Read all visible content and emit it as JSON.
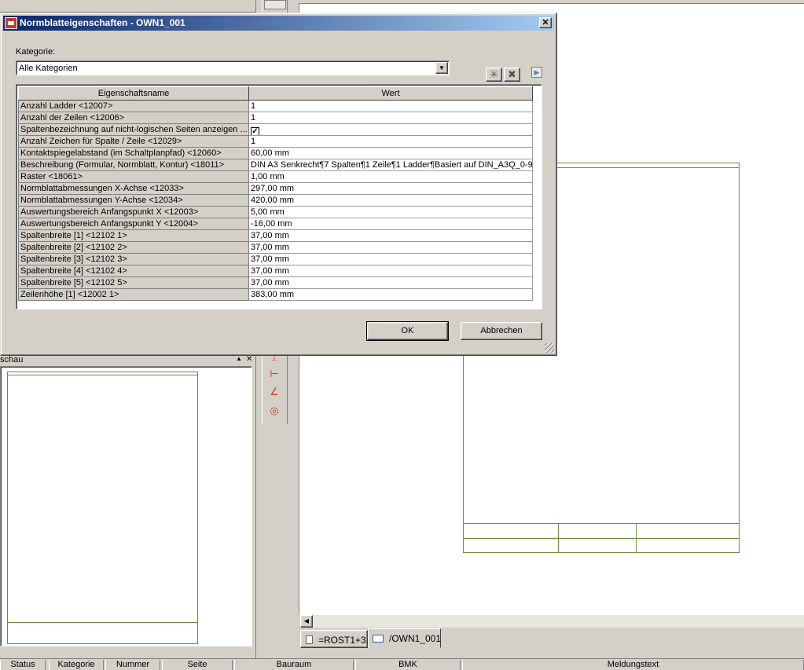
{
  "dialog": {
    "title": "Normblatteigenschaften - OWN1_001",
    "category_label": "Kategorie:",
    "category_value": "Alle Kategorien",
    "columns": {
      "name": "Eigenschaftsname",
      "value": "Wert"
    },
    "rows": [
      {
        "name": "Anzahl Ladder <12007>",
        "value": "1"
      },
      {
        "name": "Anzahl der Zeilen <12006>",
        "value": "1"
      },
      {
        "name": "Spaltenbezeichnung auf nicht-logischen Seiten anzeigen ...",
        "value": "✓",
        "checkbox": true
      },
      {
        "name": "Anzahl Zeichen für Spalte / Zeile <12029>",
        "value": "1"
      },
      {
        "name": "Kontaktspiegelabstand (im Schaltplanpfad) <12060>",
        "value": "60,00 mm"
      },
      {
        "name": "Beschreibung (Formular, Normblatt, Kontur) <18011>",
        "value": "DIN A3 Senkrecht¶7 Spalten¶1 Zeile¶1 Ladder¶Basiert auf DIN_A3Q_0-9"
      },
      {
        "name": "Raster <18061>",
        "value": "1,00 mm"
      },
      {
        "name": "Normblattabmessungen X-Achse <12033>",
        "value": "297,00 mm"
      },
      {
        "name": "Normblattabmessungen Y-Achse <12034>",
        "value": "420,00 mm"
      },
      {
        "name": "Auswertungsbereich Anfangspunkt X <12003>",
        "value": "5,00 mm"
      },
      {
        "name": "Auswertungsbereich Anfangspunkt Y <12004>",
        "value": "-16,00 mm"
      },
      {
        "name": "Spaltenbreite [1] <12102 1>",
        "value": "37,00 mm"
      },
      {
        "name": "Spaltenbreite [2] <12102 2>",
        "value": "37,00 mm"
      },
      {
        "name": "Spaltenbreite [3] <12102 3>",
        "value": "37,00 mm"
      },
      {
        "name": "Spaltenbreite [4] <12102 4>",
        "value": "37,00 mm"
      },
      {
        "name": "Spaltenbreite [5] <12102 5>",
        "value": "37,00 mm"
      },
      {
        "name": "Zeilenhöhe [1] <12002 1>",
        "value": "383,00 mm"
      }
    ],
    "ok_label": "OK",
    "cancel_label": "Abbrechen",
    "close_glyph": "✕",
    "combo_arrow": "▼",
    "new_glyph": "✳",
    "delete_glyph": "✖",
    "expand_glyph": "▶"
  },
  "preview": {
    "title": "schau",
    "up_glyph": "▲",
    "close_glyph": "✕"
  },
  "tabs": [
    {
      "label": "=ROST1+3..."
    },
    {
      "label": "/OWN1_001"
    }
  ],
  "status_columns": [
    "Status",
    "Kategorie",
    "Nummer",
    "Seite",
    "Bauraum",
    "BMK",
    "Meldungstext"
  ],
  "scroll_left_glyph": "◀",
  "accent_colors": {
    "title_start": "#0a246a",
    "title_end": "#a6caf0",
    "sheet_line": "#6b8e3e"
  }
}
